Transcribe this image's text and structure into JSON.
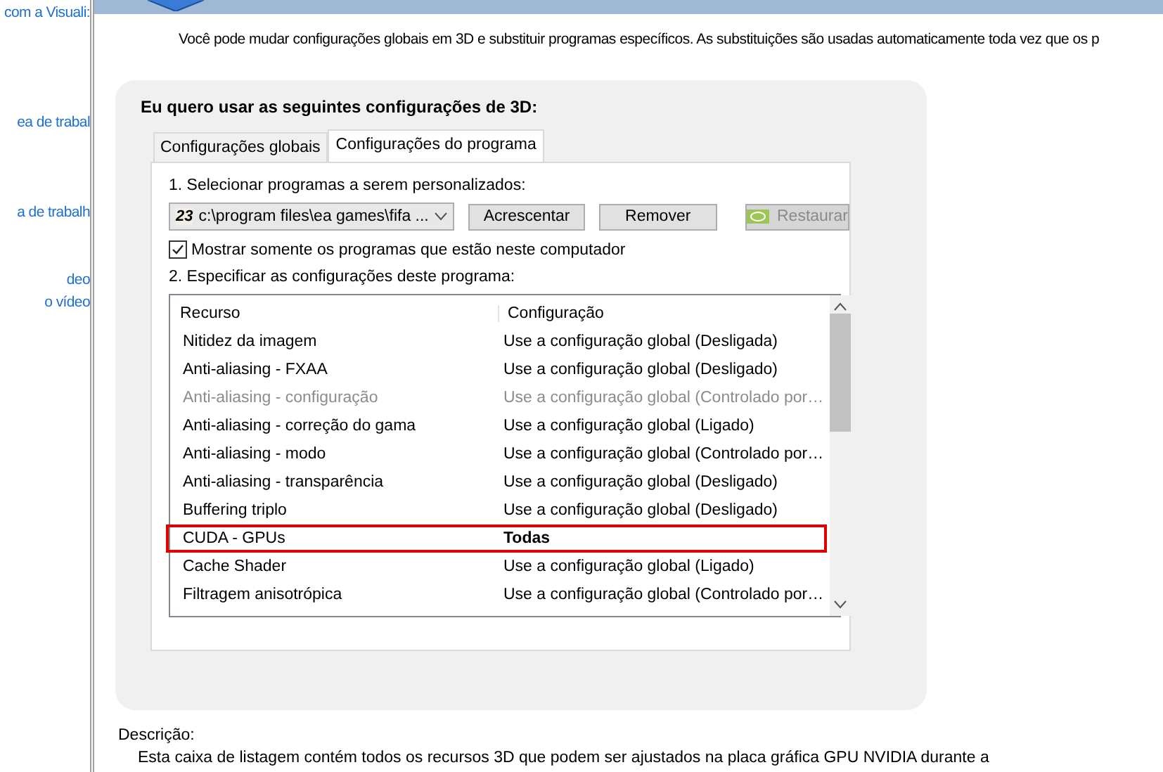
{
  "sidebar": {
    "links": [
      "com a Visuali:",
      "ea de trabal",
      "a de trabalh",
      "deo",
      "o vídeo"
    ]
  },
  "intro": "Você pode mudar configurações globais em 3D e substituir programas específicos. As substituições são usadas automaticamente toda vez que os p",
  "panel": {
    "title": "Eu quero usar as seguintes configurações de 3D:",
    "tabs": [
      {
        "label": "Configurações globais",
        "selected": false
      },
      {
        "label": "Configurações do programa",
        "selected": true
      }
    ],
    "step1": "1. Selecionar programas a serem personalizados:",
    "program_select": {
      "icon_text": "23",
      "value": "c:\\program files\\ea games\\fifa ..."
    },
    "buttons": [
      {
        "label": "Acrescentar",
        "disabled": false
      },
      {
        "label": "Remover",
        "disabled": false
      },
      {
        "label": "Restaurar",
        "disabled": true
      }
    ],
    "show_only_checkbox": {
      "label": "Mostrar somente os programas que estão neste computador",
      "checked": true
    },
    "step2": "2. Especificar as configurações deste programa:",
    "table": {
      "columns": [
        "Recurso",
        "Configuração"
      ],
      "rows": [
        {
          "feature": "Nitidez da imagem",
          "setting": "Use a configuração global (Desligada)",
          "disabled": false,
          "bold": false,
          "highlighted": false
        },
        {
          "feature": "Anti-aliasing - FXAA",
          "setting": "Use a configuração global (Desligado)",
          "disabled": false,
          "bold": false,
          "highlighted": false
        },
        {
          "feature": "Anti-aliasing - configuração",
          "setting": "Use a configuração global (Controlado por…",
          "disabled": true,
          "bold": false,
          "highlighted": false
        },
        {
          "feature": "Anti-aliasing - correção do gama",
          "setting": "Use a configuração global (Ligado)",
          "disabled": false,
          "bold": false,
          "highlighted": false
        },
        {
          "feature": "Anti-aliasing - modo",
          "setting": "Use a configuração global (Controlado por…",
          "disabled": false,
          "bold": false,
          "highlighted": false
        },
        {
          "feature": "Anti-aliasing - transparência",
          "setting": "Use a configuração global (Desligado)",
          "disabled": false,
          "bold": false,
          "highlighted": false
        },
        {
          "feature": "Buffering triplo",
          "setting": "Use a configuração global (Desligado)",
          "disabled": false,
          "bold": false,
          "highlighted": false
        },
        {
          "feature": "CUDA - GPUs",
          "setting": "Todas",
          "disabled": false,
          "bold": true,
          "highlighted": true
        },
        {
          "feature": "Cache Shader",
          "setting": "Use a configuração global (Ligado)",
          "disabled": false,
          "bold": false,
          "highlighted": false
        },
        {
          "feature": "Filtragem anisotrópica",
          "setting": "Use a configuração global (Controlado por…",
          "disabled": false,
          "bold": false,
          "highlighted": false
        }
      ]
    }
  },
  "description": {
    "label": "Descrição:",
    "text": "Esta caixa de listagem contém todos os recursos 3D que podem ser ajustados na placa gráfica GPU NVIDIA durante a"
  }
}
